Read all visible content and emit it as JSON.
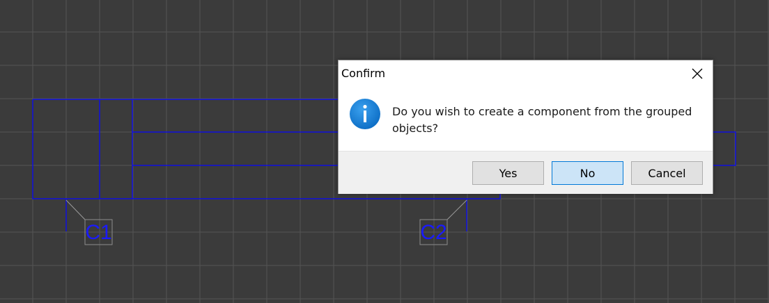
{
  "canvas": {
    "background": "#3b3b3b",
    "grid_color": "#555555",
    "wire_color": "#1010e0",
    "label_box_color": "#8c8c8c",
    "labels": [
      "C1",
      "C2"
    ]
  },
  "dialog": {
    "title": "Confirm",
    "close_icon": "close-icon",
    "icon": "info-icon",
    "message": "Do you wish to create a component from the grouped objects?",
    "buttons": {
      "yes": "Yes",
      "no": "No",
      "cancel": "Cancel"
    },
    "default_button": "no",
    "accent": "#0078d7"
  }
}
